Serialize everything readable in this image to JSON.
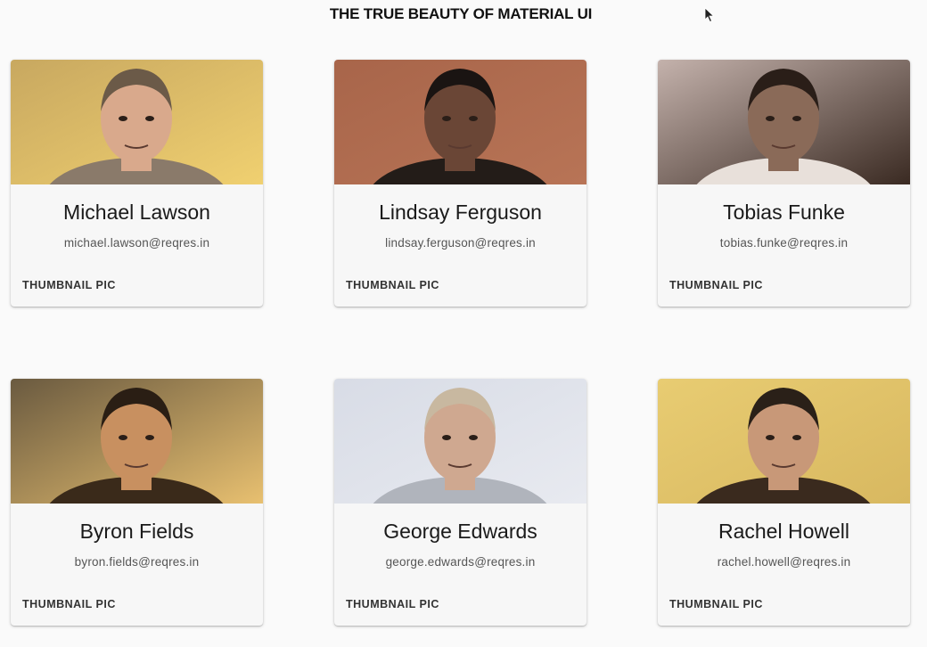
{
  "app": {
    "title": "THE TRUE BEAUTY OF MATERIAL UI"
  },
  "cards": [
    {
      "name": "Michael Lawson",
      "email": "michael.lawson@reqres.in",
      "action_label": "THUMBNAIL PIC",
      "avatar": {
        "bg": "#c8a860",
        "skin": "#d9a98c",
        "hair": "#6b5a48",
        "shirt": "#8a7a6a",
        "accent": "#f0d070"
      }
    },
    {
      "name": "Lindsay Ferguson",
      "email": "lindsay.ferguson@reqres.in",
      "action_label": "THUMBNAIL PIC",
      "avatar": {
        "bg": "#a8654a",
        "skin": "#6a4636",
        "hair": "#1a1412",
        "shirt": "#231c18",
        "accent": "#b87456"
      }
    },
    {
      "name": "Tobias Funke",
      "email": "tobias.funke@reqres.in",
      "action_label": "THUMBNAIL PIC",
      "avatar": {
        "bg": "#c4b2ac",
        "skin": "#8a6a58",
        "hair": "#2a1e18",
        "shirt": "#e8e0da",
        "accent": "#3a2a22"
      }
    },
    {
      "name": "Byron Fields",
      "email": "byron.fields@reqres.in",
      "action_label": "THUMBNAIL PIC",
      "avatar": {
        "bg": "#6a5a40",
        "skin": "#c89060",
        "hair": "#2a1e14",
        "shirt": "#3a2a1a",
        "accent": "#e8c070"
      }
    },
    {
      "name": "George Edwards",
      "email": "george.edwards@reqres.in",
      "action_label": "THUMBNAIL PIC",
      "avatar": {
        "bg": "#d8dce6",
        "skin": "#cfa890",
        "hair": "#c8b8a0",
        "shirt": "#b0b4bc",
        "accent": "#e8eaf0"
      }
    },
    {
      "name": "Rachel Howell",
      "email": "rachel.howell@reqres.in",
      "action_label": "THUMBNAIL PIC",
      "avatar": {
        "bg": "#e8cc72",
        "skin": "#c89878",
        "hair": "#2a2018",
        "shirt": "#3a2a1e",
        "accent": "#d8b860"
      }
    }
  ]
}
